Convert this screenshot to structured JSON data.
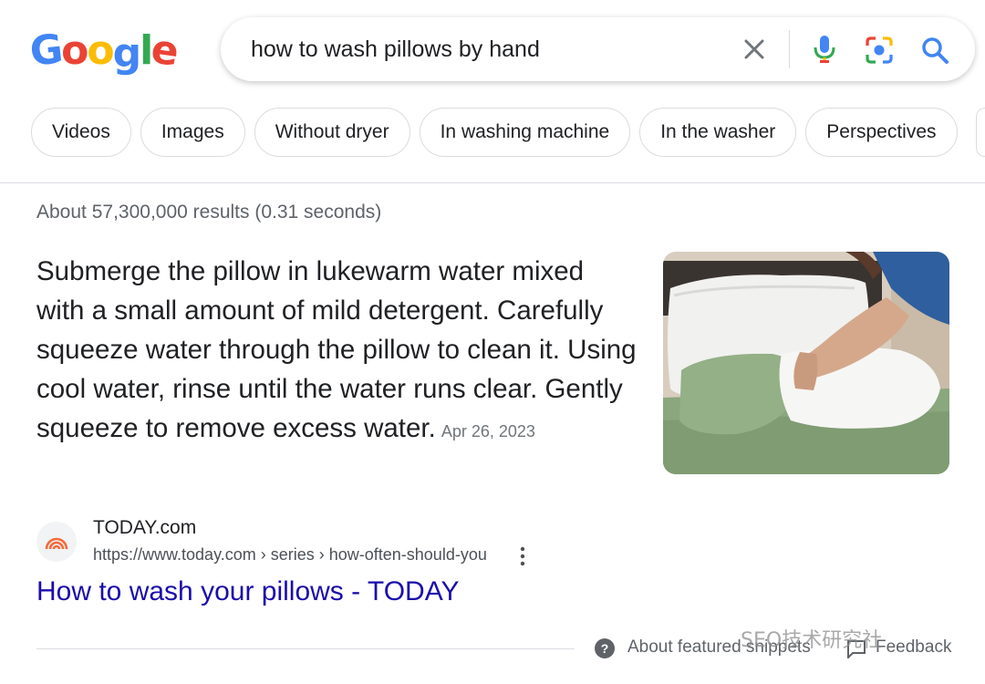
{
  "logo": {
    "letters": [
      "G",
      "o",
      "o",
      "g",
      "l",
      "e"
    ],
    "colors": [
      "#4285f4",
      "#ea4335",
      "#fbbc05",
      "#4285f4",
      "#34a853",
      "#ea4335"
    ]
  },
  "search": {
    "query": "how to wash pillows by hand",
    "icons": [
      "close-icon",
      "mic-icon",
      "lens-icon",
      "search-icon"
    ]
  },
  "chips": [
    {
      "label": "Videos"
    },
    {
      "label": "Images"
    },
    {
      "label": "Without dryer"
    },
    {
      "label": "In washing machine"
    },
    {
      "label": "In the washer"
    },
    {
      "label": "Perspectives"
    }
  ],
  "results_stats": "About 57,300,000 results (0.31 seconds)",
  "featured_snippet": {
    "text": "Submerge the pillow in lukewarm water mixed with a small amount of mild detergent. Carefully squeeze water through the pillow to clean it. Using cool water, rinse until the water runs clear. Gently squeeze to remove excess water.",
    "date": "Apr 26, 2023"
  },
  "source": {
    "site_name": "TODAY.com",
    "url": "https://www.today.com › series › how-often-should-you",
    "title": "How to wash your pillows - TODAY"
  },
  "footer": {
    "about_label": "About featured snippets",
    "feedback_label": "Feedback"
  },
  "watermark": "SEO技术研究社",
  "colors": {
    "link": "#1a0dab",
    "text": "#202124",
    "muted": "#5f6368",
    "border": "#dadce0"
  }
}
